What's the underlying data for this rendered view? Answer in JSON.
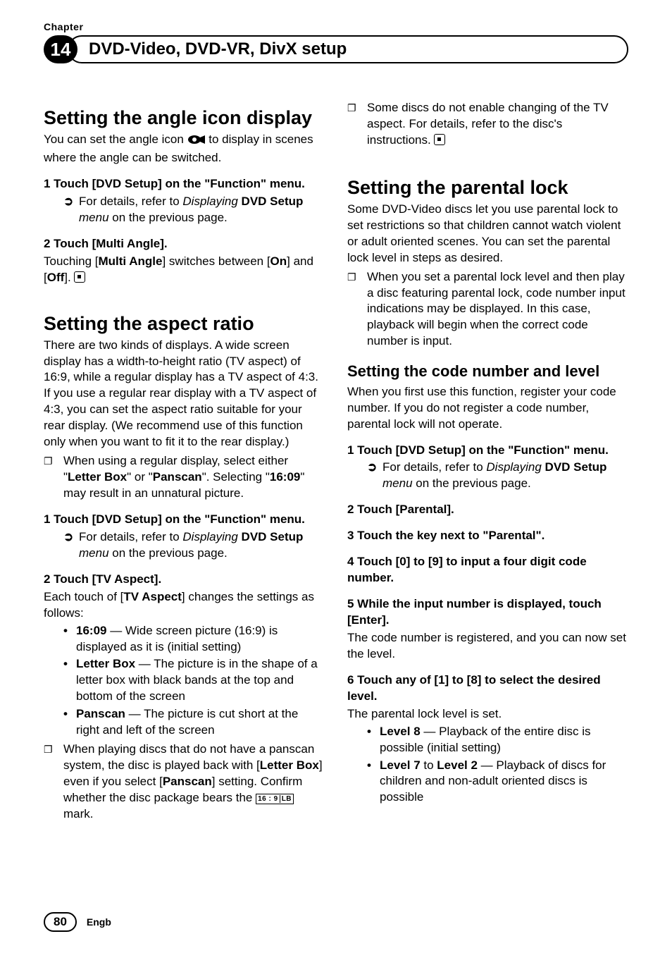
{
  "header": {
    "chapter_label": "Chapter",
    "chapter_number": "14",
    "title": "DVD-Video, DVD-VR, DivX setup"
  },
  "left": {
    "s1_title": "Setting the angle icon display",
    "s1_intro_a": "You can set the angle icon ",
    "s1_intro_b": " to display in scenes where the angle can be switched.",
    "s1_step1": "1   Touch [DVD Setup] on the \"Function\" menu.",
    "s1_step1_sub_a": "For details, refer to ",
    "s1_step1_sub_i": "Displaying ",
    "s1_step1_sub_b": "DVD Setup",
    "s1_step1_sub_c": " menu",
    "s1_step1_sub_d": " on the previous page.",
    "s1_step2": "2   Touch [Multi Angle].",
    "s1_step2_text_a": "Touching [",
    "s1_step2_text_b": "Multi Angle",
    "s1_step2_text_c": "] switches between [",
    "s1_step2_text_d": "On",
    "s1_step2_text_e": "] and [",
    "s1_step2_text_f": "Off",
    "s1_step2_text_g": "]. ",
    "s2_title": "Setting the aspect ratio",
    "s2_intro": "There are two kinds of displays. A wide screen display has a width-to-height ratio (TV aspect) of 16:9, while a regular display has a TV aspect of 4:3. If you use a regular rear display with a TV aspect of 4:3, you can set the aspect ratio suitable for your rear display. (We recommend use of this function only when you want to fit it to the rear display.)",
    "s2_note1_a": "When using a regular display, select either \"",
    "s2_note1_b": "Letter Box",
    "s2_note1_c": "\" or \"",
    "s2_note1_d": "Panscan",
    "s2_note1_e": "\". Selecting \"",
    "s2_note1_f": "16:09",
    "s2_note1_g": "\" may result in an unnatural picture.",
    "s2_step1": "1   Touch [DVD Setup] on the \"Function\" menu.",
    "s2_step1_sub_a": "For details, refer to ",
    "s2_step1_sub_i": "Displaying ",
    "s2_step1_sub_b": "DVD Setup",
    "s2_step1_sub_c": " menu",
    "s2_step1_sub_d": " on the previous page.",
    "s2_step2": "2   Touch [TV Aspect].",
    "s2_step2_text_a": "Each touch of [",
    "s2_step2_text_b": "TV Aspect",
    "s2_step2_text_c": "] changes the settings as follows:",
    "s2_opt1_a": "16:09",
    "s2_opt1_b": " — Wide screen picture (16:9) is displayed as it is (initial setting)",
    "s2_opt2_a": "Letter Box",
    "s2_opt2_b": " — The picture is in the shape of a letter box with black bands at the top and bottom of the screen",
    "s2_opt3_a": "Panscan",
    "s2_opt3_b": " — The picture is cut short at the right and left of the screen",
    "s2_note2_a": "When playing discs that do not have a panscan system, the disc is played back with [",
    "s2_note2_b": "Letter Box",
    "s2_note2_c": "] even if you select [",
    "s2_note2_d": "Panscan",
    "s2_note2_e": "] setting. Confirm whether the disc package bears the ",
    "s2_note2_f": " mark."
  },
  "right": {
    "r_note1": "Some discs do not enable changing of the TV aspect. For details, refer to the disc's instructions. ",
    "s3_title": "Setting the parental lock",
    "s3_intro": "Some DVD-Video discs let you use parental lock to set restrictions so that children cannot watch violent or adult oriented scenes. You can set the parental lock level in steps as desired.",
    "s3_note1": "When you set a parental lock level and then play a disc featuring parental lock, code number input indications may be displayed. In this case, playback will begin when the correct code number is input.",
    "s4_title": "Setting the code number and level",
    "s4_intro": "When you first use this function, register your code number. If you do not register a code number, parental lock will not operate.",
    "s4_step1": "1   Touch [DVD Setup] on the \"Function\" menu.",
    "s4_step1_sub_a": "For details, refer to ",
    "s4_step1_sub_i": "Displaying ",
    "s4_step1_sub_b": "DVD Setup",
    "s4_step1_sub_c": " menu",
    "s4_step1_sub_d": " on the previous page.",
    "s4_step2": "2   Touch [Parental].",
    "s4_step3": "3   Touch the key next to \"Parental\".",
    "s4_step4": "4   Touch [0] to [9] to input a four digit code number.",
    "s4_step5": "5   While the input number is displayed, touch [Enter].",
    "s4_step5_text": "The code number is registered, and you can now set the level.",
    "s4_step6": "6   Touch any of [1] to [8] to select the desired level.",
    "s4_step6_text": "The parental lock level is set.",
    "s4_opt1_a": "Level 8",
    "s4_opt1_b": " — Playback of the entire disc is possible (initial setting)",
    "s4_opt2_a": "Level 7",
    "s4_opt2_mid": " to ",
    "s4_opt2_b": "Level 2",
    "s4_opt2_c": " — Playback of discs for children and non-adult oriented discs is possible"
  },
  "footer": {
    "page": "80",
    "lang": "Engb"
  }
}
